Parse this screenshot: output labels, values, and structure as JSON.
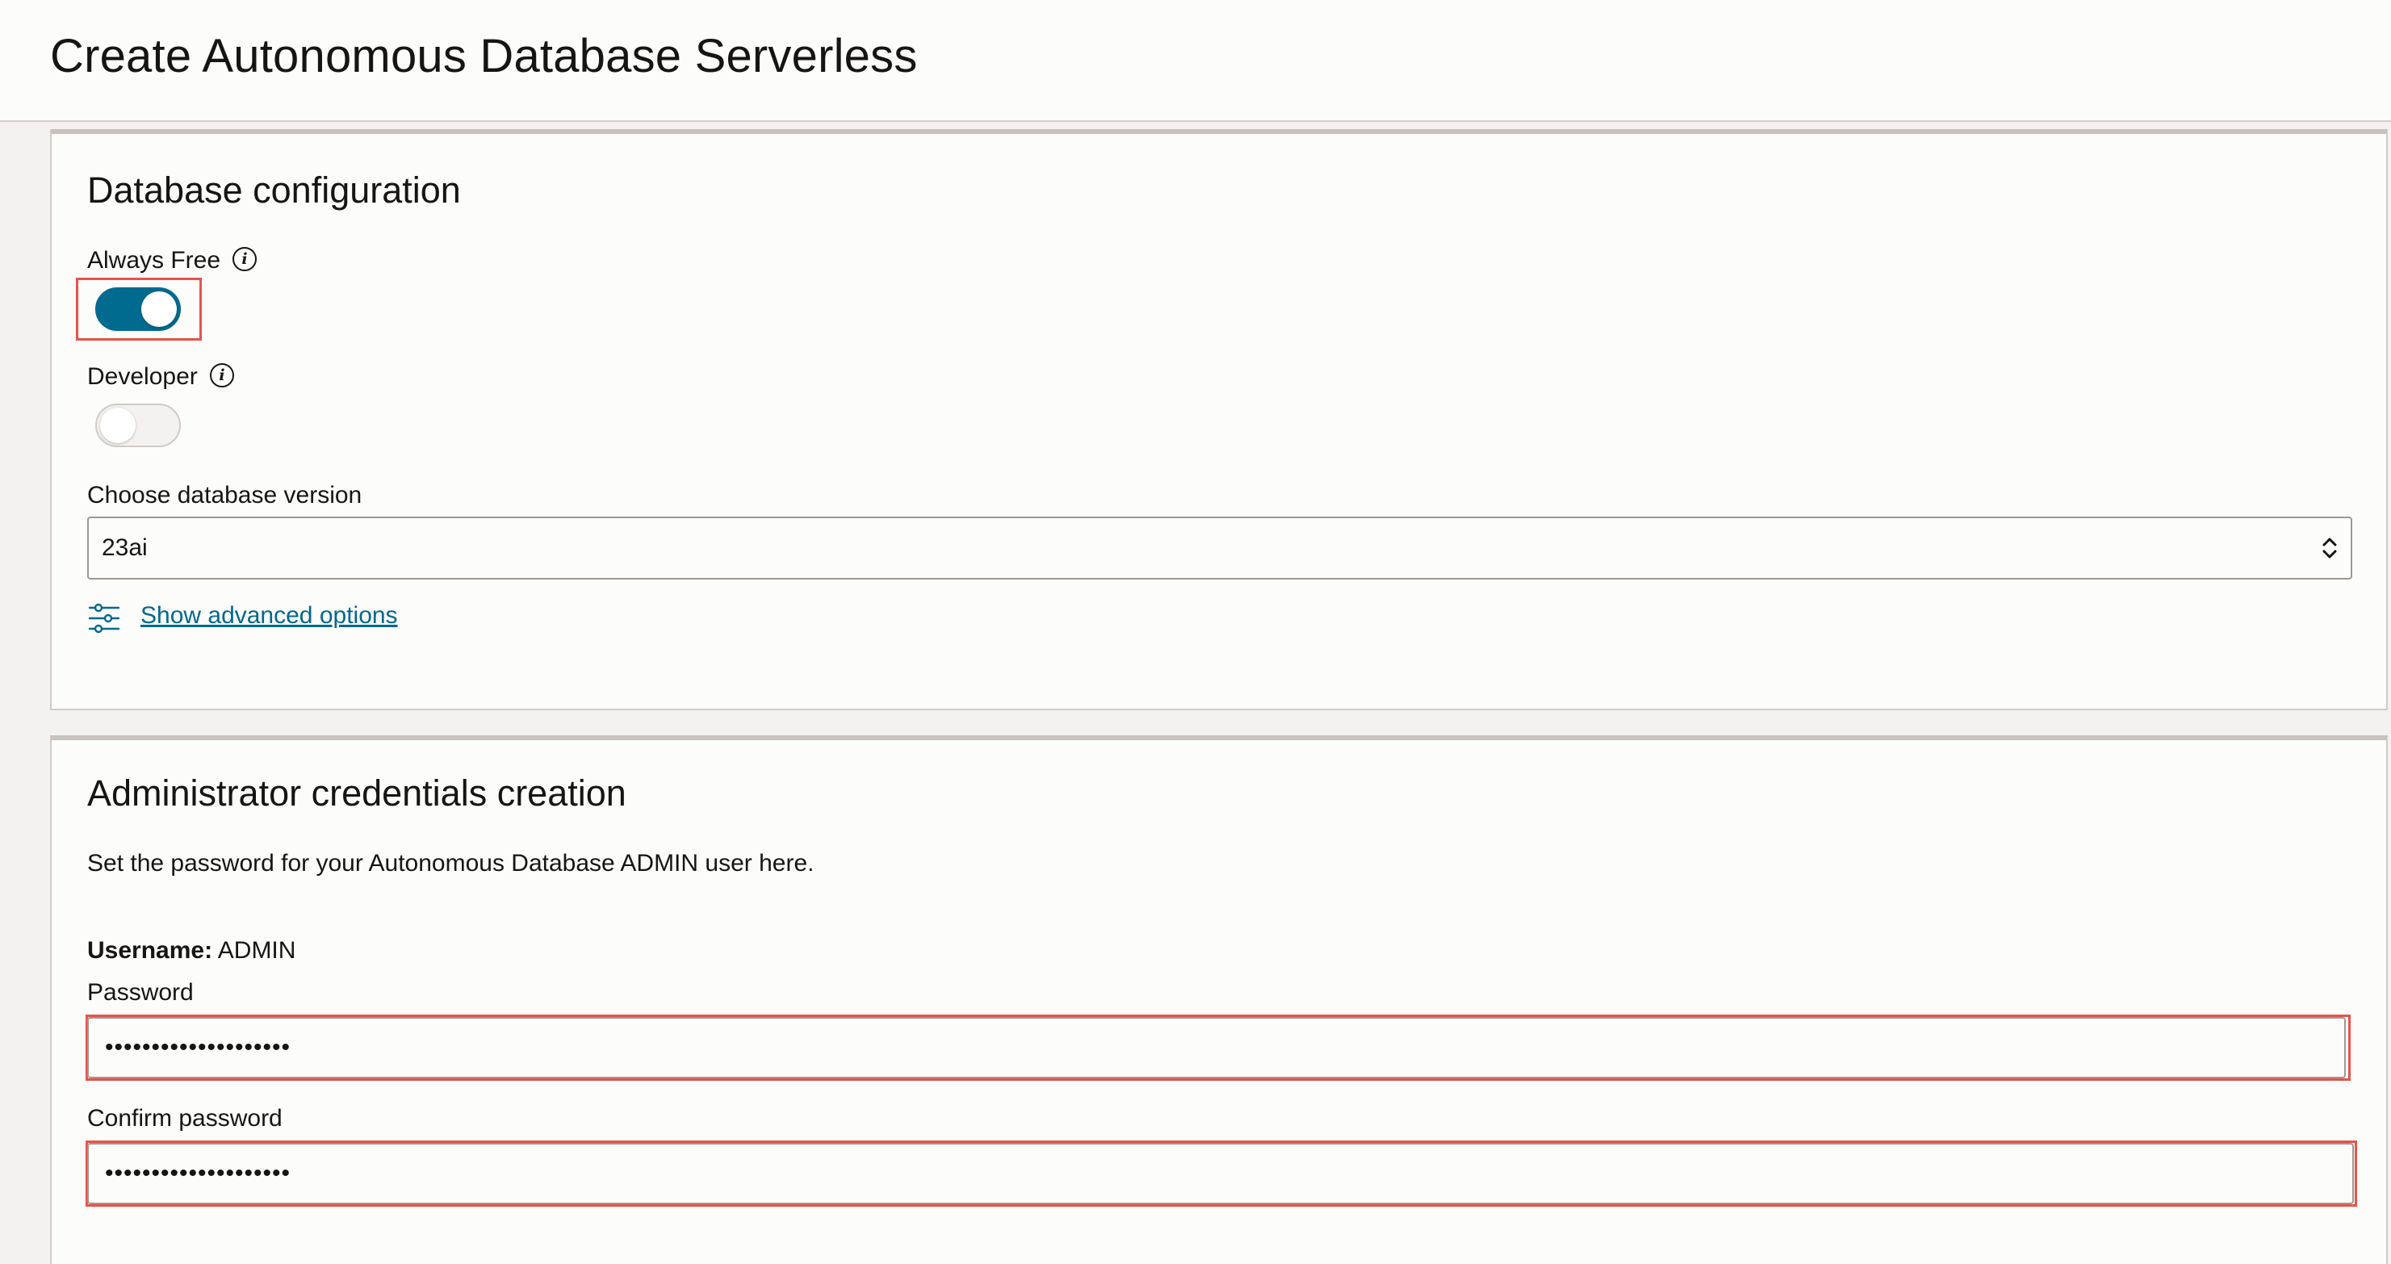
{
  "page": {
    "title": "Create Autonomous Database Serverless"
  },
  "db_config": {
    "title": "Database configuration",
    "always_free": {
      "label": "Always Free",
      "info_icon": "info-icon",
      "state": "on"
    },
    "developer": {
      "label": "Developer",
      "info_icon": "info-icon",
      "state": "off"
    },
    "version": {
      "label": "Choose database version",
      "value": "23ai"
    },
    "advanced_link": {
      "icon": "sliders-icon",
      "label": "Show advanced options"
    }
  },
  "admin": {
    "title": "Administrator credentials creation",
    "description": "Set the password for your Autonomous Database ADMIN user here.",
    "username_label": "Username:",
    "username_value": "ADMIN",
    "password_label": "Password",
    "password_value": "••••••••••••••••••••",
    "confirm_label": "Confirm password",
    "confirm_value": "••••••••••••••••••••"
  },
  "colors": {
    "accent": "#006b8f",
    "link": "#00688c",
    "highlight": "#e5534b"
  }
}
